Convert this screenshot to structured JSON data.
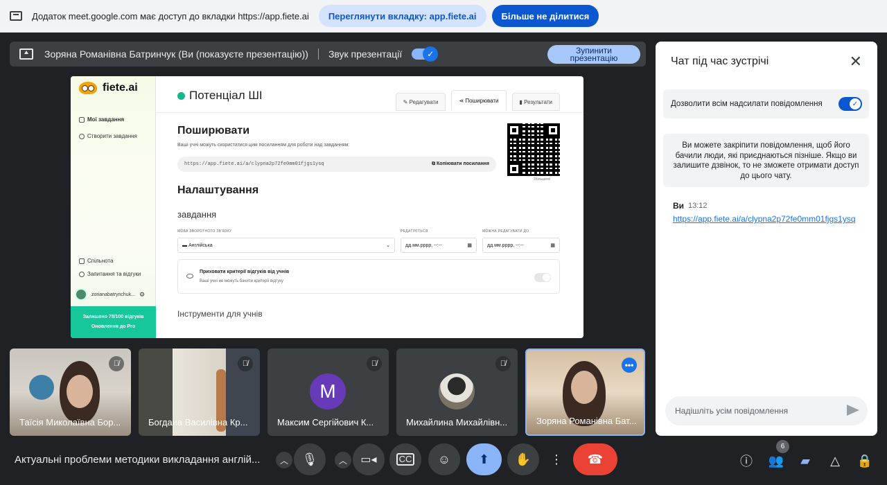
{
  "sharebar": {
    "notice": "Додаток meet.google.com має доступ до вкладки https://app.fiete.ai",
    "view_tab": "Переглянути вкладку: app.fiete.ai",
    "stop_sharing": "Більше не ділитися"
  },
  "presenting": {
    "presenter": "Зоряна Романівна Батринчук (Ви (показуєте презентацію))",
    "audio_label": "Звук презентації",
    "audio_on": true,
    "stop_button": "Зупинити презентацію"
  },
  "shared_screen": {
    "logo": "fiete.ai",
    "nav": [
      "Мої завдання",
      "Створити завдання"
    ],
    "bottom_nav": [
      "Спільнота",
      "Запитання та відгуки"
    ],
    "user": "zorianabatrynchuk...",
    "quota": "Залишено 78/100 відгуків",
    "upgrade": "Оновлення до Pro",
    "page_title": "Потенціал ШІ",
    "tabs": [
      "Редагувати",
      "Поширювати",
      "Результати"
    ],
    "active_tab": "Поширювати",
    "share_heading": "Поширювати",
    "share_desc": "Ваші учні можуть скористатися цим посиланням для роботи над завданням:",
    "share_url": "https://app.fiete.ai/a/clypna2p72fe0mm01fjgs1ysq",
    "copy_link": "Копіювати посилання",
    "qr_caption": "Збільшити",
    "settings_heading": "Налаштування",
    "task_heading": "завдання",
    "feedback_lang_label": "МОВА ЗВОРОТНОГО ЗВ'ЯЗКУ",
    "feedback_lang": "Англійська",
    "editable_label": "РЕДАГУЄТЬСЯ",
    "editable_until_label": "МОЖНА РЕДАГУВАТИ ДО",
    "date_placeholder": "дд.мм.рррр, --:--",
    "hide_criteria_title": "Приховати критерії відгуків від учнів",
    "hide_criteria_desc": "Ваші учні не можуть бачити критерії відгуку",
    "tools_heading": "Інструменти для учнів"
  },
  "participants": [
    {
      "name": "Таїсія Миколаївна Бор..."
    },
    {
      "name": "Богдана Василівна Кр..."
    },
    {
      "name": "Максим Сергійович К...",
      "initial": "M"
    },
    {
      "name": "Михайлина Михайлівн..."
    },
    {
      "name": "Зоряна Романівна Бат..."
    }
  ],
  "chat": {
    "title": "Чат під час зустрічі",
    "allow_label": "Дозволити всім надсилати повідомлення",
    "allow_on": true,
    "pin_note": "Ви можете закріпити повідомлення, щоб його бачили люди, які приєднаються пізніше. Якщо ви залишите дзвінок, то не зможете отримати доступ до цього чату.",
    "messages": [
      {
        "author": "Ви",
        "time": "13:12",
        "text": "https://app.fiete.ai/a/clypna2p72fe0mm01fjgs1ysq"
      }
    ],
    "input_placeholder": "Надішліть усім повідомлення"
  },
  "meeting": {
    "title": "Актуальні проблеми методики викладання англій...",
    "people_count": "6"
  },
  "colors": {
    "accent": "#0b57d0",
    "present": "#8ab4f8",
    "hangup": "#ea4335"
  }
}
